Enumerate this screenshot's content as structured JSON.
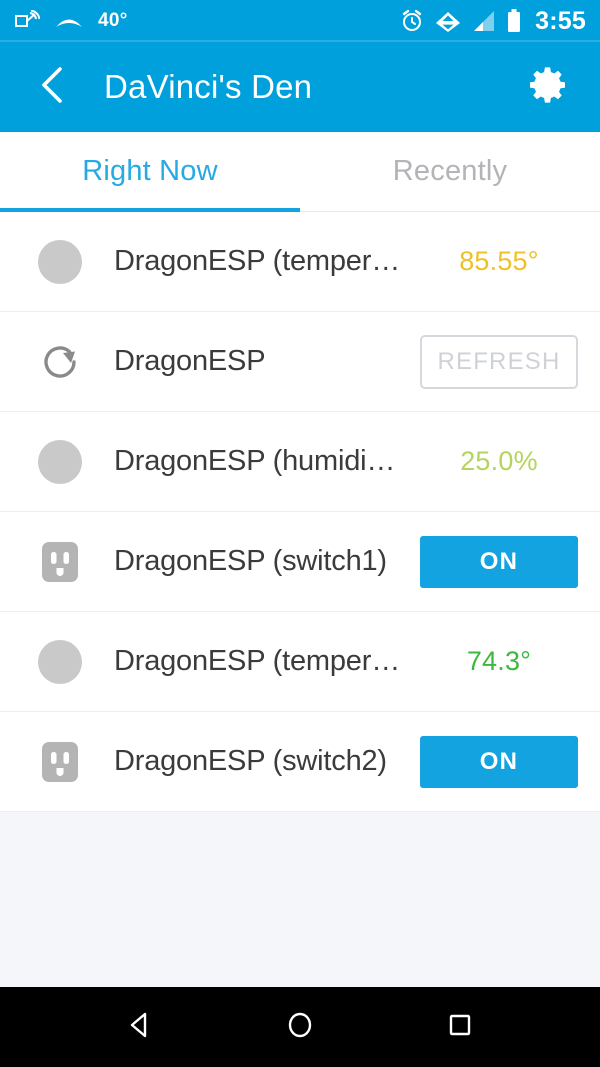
{
  "status_bar": {
    "background": "#00a0dc",
    "weather_temp": "40°",
    "clock": "3:55",
    "icons_left": [
      "cast-screen-icon",
      "weather-cloud-icon"
    ],
    "icons_right": [
      "alarm-icon",
      "wifi-icon",
      "cell-signal-icon",
      "battery-icon"
    ]
  },
  "app_bar": {
    "title": "DaVinci's Den",
    "back_icon": "back-chevron-icon",
    "settings_icon": "gear-icon",
    "background": "#00a0dc"
  },
  "tabs": {
    "active_index": 0,
    "accent": "#12a3e0",
    "items": [
      {
        "label": "Right Now"
      },
      {
        "label": "Recently"
      }
    ]
  },
  "device_list": [
    {
      "icon": "sensor-dot-icon",
      "label": "DragonESP (temper…",
      "control": "value",
      "value": "85.55°",
      "value_color": "#efc124"
    },
    {
      "icon": "refresh-arrow-icon",
      "label": "DragonESP",
      "control": "refresh-button",
      "value": "REFRESH",
      "value_color": "#cfd1d7"
    },
    {
      "icon": "sensor-dot-icon",
      "label": "DragonESP (humidi…",
      "control": "value",
      "value": "25.0%",
      "value_color": "#b5d45e"
    },
    {
      "icon": "outlet-icon",
      "label": "DragonESP (switch1)",
      "control": "on-button",
      "value": "ON",
      "value_color": "#ffffff"
    },
    {
      "icon": "sensor-dot-icon",
      "label": "DragonESP (temper…",
      "control": "value",
      "value": "74.3°",
      "value_color": "#3cb93c"
    },
    {
      "icon": "outlet-icon",
      "label": "DragonESP (switch2)",
      "control": "on-button",
      "value": "ON",
      "value_color": "#ffffff"
    }
  ],
  "nav_bar": {
    "background": "#000000",
    "buttons": [
      "back-triangle-icon",
      "home-circle-icon",
      "recents-square-icon"
    ]
  }
}
